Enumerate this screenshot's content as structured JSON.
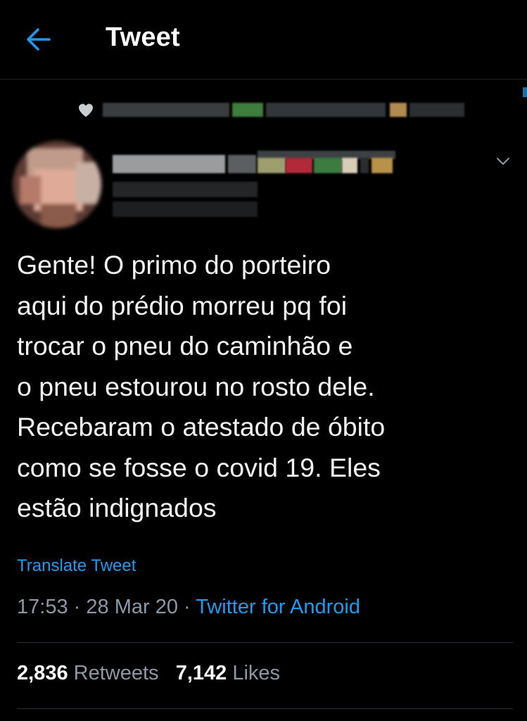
{
  "header": {
    "back_icon": "arrow-left-icon",
    "title": "Tweet"
  },
  "colors": {
    "accent": "#1d9bf0",
    "background": "#000000",
    "secondary_text": "#8b98a5"
  },
  "liked_by": {
    "icon": "heart-icon"
  },
  "author": {
    "menu_icon": "chevron-down-icon"
  },
  "tweet": {
    "text": "Gente! O primo do porteiro\naqui do prédio morreu pq foi\ntrocar o pneu do caminhão e\no pneu estourou no rosto dele.\nRecebaram o atestado de óbito\ncomo se fosse o covid 19. Eles\nestão indignados",
    "translate_label": "Translate Tweet",
    "time": "17:53",
    "separator": "·",
    "date": "28 Mar 20",
    "source": "Twitter for Android"
  },
  "stats": {
    "retweets_count": "2,836",
    "retweets_label": "Retweets",
    "likes_count": "7,142",
    "likes_label": "Likes"
  }
}
